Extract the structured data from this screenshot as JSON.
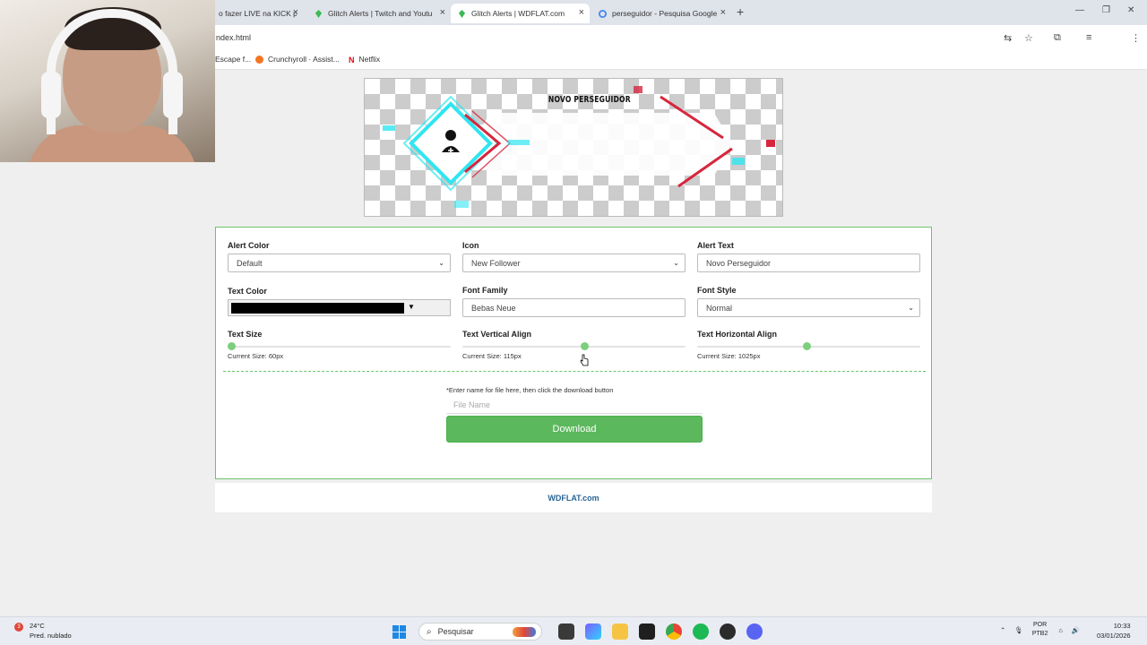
{
  "browser": {
    "tabs": [
      {
        "title": "o fazer LIVE na KICK p",
        "active": false
      },
      {
        "title": "Glitch Alerts | Twitch and Youtu",
        "active": false
      },
      {
        "title": "Glitch Alerts | WDFLAT.com",
        "active": true
      },
      {
        "title": "perseguidor - Pesquisa Google",
        "active": false
      }
    ],
    "new_tab": "+",
    "url": "ndex.html",
    "bookmarks": [
      {
        "label": "Escape f..."
      },
      {
        "label": "Crunchyroll · Assist..."
      },
      {
        "label": "Netflix"
      }
    ]
  },
  "preview": {
    "banner_text": "NOVO PERSEGUIDOR"
  },
  "form": {
    "alert_color": {
      "label": "Alert Color",
      "value": "Default"
    },
    "icon": {
      "label": "Icon",
      "value": "New Follower"
    },
    "alert_text": {
      "label": "Alert Text",
      "value": "Novo Perseguidor"
    },
    "text_color": {
      "label": "Text Color",
      "value": "#000000"
    },
    "font_family": {
      "label": "Font Family",
      "value": "Bebas Neue"
    },
    "font_style": {
      "label": "Font Style",
      "value": "Normal"
    },
    "text_size": {
      "label": "Text Size",
      "current": "Current Size: 60px",
      "fraction": 0.0
    },
    "text_vertical_align": {
      "label": "Text Vertical Align",
      "current": "Current Size: 115px",
      "fraction": 0.55
    },
    "text_horizontal_align": {
      "label": "Text Horizontal Align",
      "current": "Current Size: 1025px",
      "fraction": 0.49
    },
    "file_note": "*Enter name for file here, then click the download button",
    "file_placeholder": "File Name",
    "download_label": "Download"
  },
  "footer": {
    "link": "WDFLAT.com"
  },
  "taskbar": {
    "weather_temp": "24°C",
    "weather_desc": "Pred. nublado",
    "weather_badge": "3",
    "search_placeholder": "Pesquisar",
    "lang_line1": "POR",
    "lang_line2": "PTB2",
    "time": "10:33",
    "date": "03/01/2026"
  },
  "colors": {
    "accent_green": "#5cb85c",
    "border_green": "#6cc46c",
    "slider_thumb": "#7dce7d",
    "footer_link": "#2a6496"
  }
}
